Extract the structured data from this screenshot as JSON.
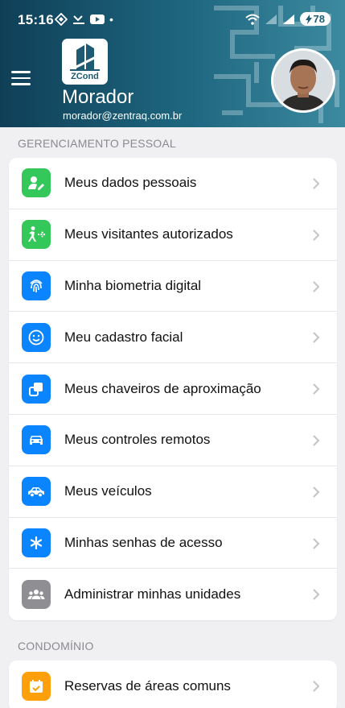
{
  "status": {
    "time": "15:16",
    "battery": "78",
    "dot": "•"
  },
  "header": {
    "logo_text": "ZCond",
    "role": "Morador",
    "email": "morador@zentraq.com.br"
  },
  "sections": [
    {
      "title": "GERENCIAMENTO PESSOAL",
      "items": [
        {
          "label": "Meus dados pessoais",
          "icon": "person-edit-icon",
          "color": "#34c759"
        },
        {
          "label": "Meus visitantes autorizados",
          "icon": "visitor-arrow-icon",
          "color": "#34c759"
        },
        {
          "label": "Minha biometria digital",
          "icon": "fingerprint-icon",
          "color": "#0a84ff"
        },
        {
          "label": "Meu cadastro facial",
          "icon": "smile-icon",
          "color": "#0a84ff"
        },
        {
          "label": "Meus chaveiros de aproximação",
          "icon": "tag-icon",
          "color": "#0a84ff"
        },
        {
          "label": "Meus controles remotos",
          "icon": "car-front-icon",
          "color": "#0a84ff"
        },
        {
          "label": "Meus veículos",
          "icon": "car-side-icon",
          "color": "#0a84ff"
        },
        {
          "label": "Minhas senhas de acesso",
          "icon": "asterisk-icon",
          "color": "#0a84ff"
        },
        {
          "label": "Administrar minhas unidades",
          "icon": "group-icon",
          "color": "#8e8e93"
        }
      ]
    },
    {
      "title": "CONDOMÍNIO",
      "items": [
        {
          "label": "Reservas de áreas comuns",
          "icon": "calendar-check-icon",
          "color": "#ff9f0a"
        }
      ]
    }
  ]
}
